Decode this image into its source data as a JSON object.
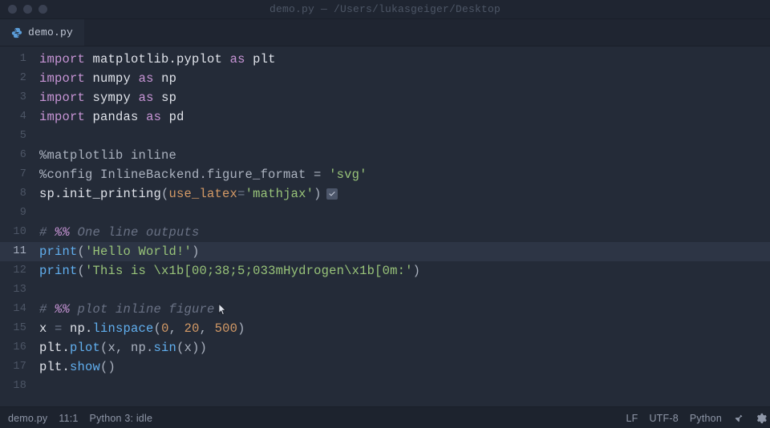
{
  "window": {
    "title": "demo.py — /Users/lukasgeiger/Desktop"
  },
  "tabs": {
    "items": [
      {
        "label": "demo.py"
      }
    ]
  },
  "code": {
    "lines": [
      {
        "n": 1,
        "tokens": [
          [
            "kw",
            "import"
          ],
          [
            "pl",
            " "
          ],
          [
            "id",
            "matplotlib.pyplot"
          ],
          [
            "pl",
            " "
          ],
          [
            "kw",
            "as"
          ],
          [
            "pl",
            " "
          ],
          [
            "id",
            "plt"
          ]
        ]
      },
      {
        "n": 2,
        "tokens": [
          [
            "kw",
            "import"
          ],
          [
            "pl",
            " "
          ],
          [
            "id",
            "numpy"
          ],
          [
            "pl",
            " "
          ],
          [
            "kw",
            "as"
          ],
          [
            "pl",
            " "
          ],
          [
            "id",
            "np"
          ]
        ]
      },
      {
        "n": 3,
        "tokens": [
          [
            "kw",
            "import"
          ],
          [
            "pl",
            " "
          ],
          [
            "id",
            "sympy"
          ],
          [
            "pl",
            " "
          ],
          [
            "kw",
            "as"
          ],
          [
            "pl",
            " "
          ],
          [
            "id",
            "sp"
          ]
        ]
      },
      {
        "n": 4,
        "tokens": [
          [
            "kw",
            "import"
          ],
          [
            "pl",
            " "
          ],
          [
            "id",
            "pandas"
          ],
          [
            "pl",
            " "
          ],
          [
            "kw",
            "as"
          ],
          [
            "pl",
            " "
          ],
          [
            "id",
            "pd"
          ]
        ]
      },
      {
        "n": 5,
        "tokens": []
      },
      {
        "n": 6,
        "tokens": [
          [
            "pl",
            "%matplotlib inline"
          ]
        ]
      },
      {
        "n": 7,
        "tokens": [
          [
            "pl",
            "%config InlineBackend.figure_format = "
          ],
          [
            "str",
            "'svg'"
          ]
        ]
      },
      {
        "n": 8,
        "tokens": [
          [
            "id",
            "sp.init_printing"
          ],
          [
            "pl",
            "("
          ],
          [
            "arg",
            "use_latex"
          ],
          [
            "op",
            "="
          ],
          [
            "str",
            "'mathjax'"
          ],
          [
            "pl",
            ")"
          ]
        ],
        "check": true
      },
      {
        "n": 9,
        "tokens": []
      },
      {
        "n": 10,
        "tokens": [
          [
            "cm",
            "# "
          ],
          [
            "mk",
            "%%"
          ],
          [
            "cm",
            " One line outputs"
          ]
        ]
      },
      {
        "n": 11,
        "current": true,
        "tokens": [
          [
            "fn",
            "print"
          ],
          [
            "pl",
            "("
          ],
          [
            "str",
            "'Hello World!'"
          ],
          [
            "pl",
            ")"
          ]
        ]
      },
      {
        "n": 12,
        "tokens": [
          [
            "fn",
            "print"
          ],
          [
            "pl",
            "("
          ],
          [
            "str",
            "'This is \\x1b[00;38;5;033mHydrogen\\x1b[0m:'"
          ],
          [
            "pl",
            ")"
          ]
        ]
      },
      {
        "n": 13,
        "tokens": []
      },
      {
        "n": 14,
        "tokens": [
          [
            "cm",
            "# "
          ],
          [
            "mk",
            "%%"
          ],
          [
            "cm",
            " plot inline figure"
          ]
        ],
        "cursor": true
      },
      {
        "n": 15,
        "tokens": [
          [
            "id",
            "x "
          ],
          [
            "op",
            "="
          ],
          [
            "id",
            " np."
          ],
          [
            "fn",
            "linspace"
          ],
          [
            "pl",
            "("
          ],
          [
            "num",
            "0"
          ],
          [
            "pl",
            ", "
          ],
          [
            "num",
            "20"
          ],
          [
            "pl",
            ", "
          ],
          [
            "num",
            "500"
          ],
          [
            "pl",
            ")"
          ]
        ]
      },
      {
        "n": 16,
        "tokens": [
          [
            "id",
            "plt."
          ],
          [
            "fn",
            "plot"
          ],
          [
            "pl",
            "(x, np."
          ],
          [
            "fn",
            "sin"
          ],
          [
            "pl",
            "(x))"
          ]
        ]
      },
      {
        "n": 17,
        "tokens": [
          [
            "id",
            "plt."
          ],
          [
            "fn",
            "show"
          ],
          [
            "pl",
            "()"
          ]
        ]
      },
      {
        "n": 18,
        "tokens": []
      }
    ]
  },
  "status": {
    "left": [
      "demo.py",
      "11:1",
      "Python 3: idle"
    ],
    "right": [
      "LF",
      "UTF-8",
      "Python"
    ]
  }
}
